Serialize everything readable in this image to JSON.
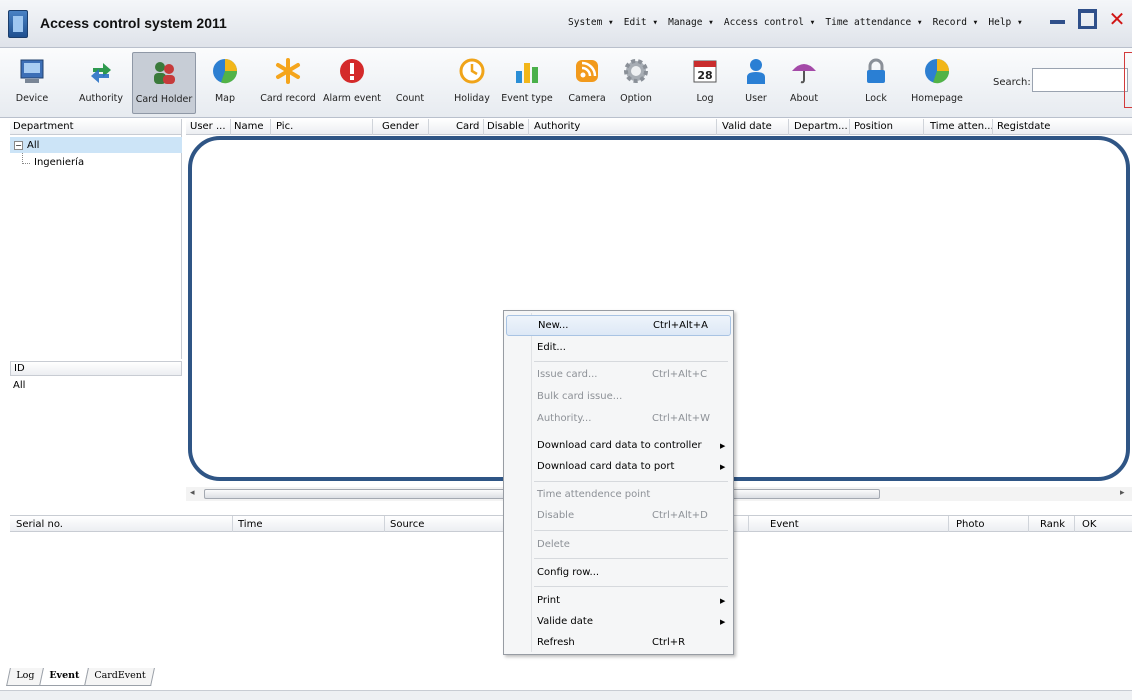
{
  "window": {
    "title": "Access control system 2011",
    "menus": [
      "System ▾",
      "Edit ▾",
      "Manage ▾",
      "Access control ▾",
      "Time attendance ▾",
      "Record ▾",
      "Help ▾"
    ]
  },
  "toolbar": {
    "buttons": [
      "Device",
      "Authority",
      "Card Holder",
      "Map",
      "Card record",
      "Alarm event",
      "Count",
      "Holiday",
      "Event type",
      "Camera",
      "Option",
      "Log",
      "User",
      "About",
      "Lock",
      "Homepage"
    ],
    "active": "Card Holder",
    "log_icon_day": "28",
    "search_label": "Search:",
    "search_value": ""
  },
  "department_panel": {
    "header": "Department",
    "root": "All",
    "root_toggle": "−",
    "children": [
      "Ingeniería"
    ]
  },
  "id_panel": {
    "header": "ID",
    "value": "All"
  },
  "grid": {
    "columns": [
      "User ...",
      "Name",
      "Pic.",
      "Gender",
      "Card",
      "Disable",
      "Authority",
      "Valid date",
      "Departm...",
      "Position",
      "Time atten...",
      "Registdate"
    ],
    "rows": []
  },
  "event_panel": {
    "columns": [
      "Serial no.",
      "Time",
      "Source",
      "Event",
      "Photo",
      "Rank",
      "OK"
    ]
  },
  "bottom_tabs": [
    "Log",
    "Event",
    "CardEvent"
  ],
  "active_tab": "Event",
  "context_menu": {
    "items": [
      {
        "label": "New...",
        "shortcut": "Ctrl+Alt+A",
        "enabled": true,
        "highlighted": true,
        "submenu": false
      },
      {
        "label": "Edit...",
        "shortcut": "",
        "enabled": true,
        "highlighted": false,
        "submenu": false
      },
      {
        "label": "Issue card...",
        "shortcut": "Ctrl+Alt+C",
        "enabled": false,
        "highlighted": false,
        "submenu": false
      },
      {
        "label": "Bulk card issue...",
        "shortcut": "",
        "enabled": false,
        "highlighted": false,
        "submenu": false
      },
      {
        "label": "Authority...",
        "shortcut": "Ctrl+Alt+W",
        "enabled": false,
        "highlighted": false,
        "submenu": false
      },
      {
        "label": "Download card data to controller",
        "shortcut": "",
        "enabled": true,
        "highlighted": false,
        "submenu": true
      },
      {
        "label": "Download card data to port",
        "shortcut": "",
        "enabled": true,
        "highlighted": false,
        "submenu": true
      },
      {
        "label": "Time attendence point",
        "shortcut": "",
        "enabled": false,
        "highlighted": false,
        "submenu": false
      },
      {
        "label": "Disable",
        "shortcut": "Ctrl+Alt+D",
        "enabled": false,
        "highlighted": false,
        "submenu": false
      },
      {
        "label": "Delete",
        "shortcut": "",
        "enabled": false,
        "highlighted": false,
        "submenu": false
      },
      {
        "label": "Config row...",
        "shortcut": "",
        "enabled": true,
        "highlighted": false,
        "submenu": false
      },
      {
        "label": "Print",
        "shortcut": "",
        "enabled": true,
        "highlighted": false,
        "submenu": true
      },
      {
        "label": "Valide date",
        "shortcut": "",
        "enabled": true,
        "highlighted": false,
        "submenu": true
      },
      {
        "label": "Refresh",
        "shortcut": "Ctrl+R",
        "enabled": true,
        "highlighted": false,
        "submenu": false
      }
    ]
  },
  "colors": {
    "highlight_border": "#2f5585",
    "close_button": "#d01515",
    "selected_tree": "#cce4f7"
  }
}
